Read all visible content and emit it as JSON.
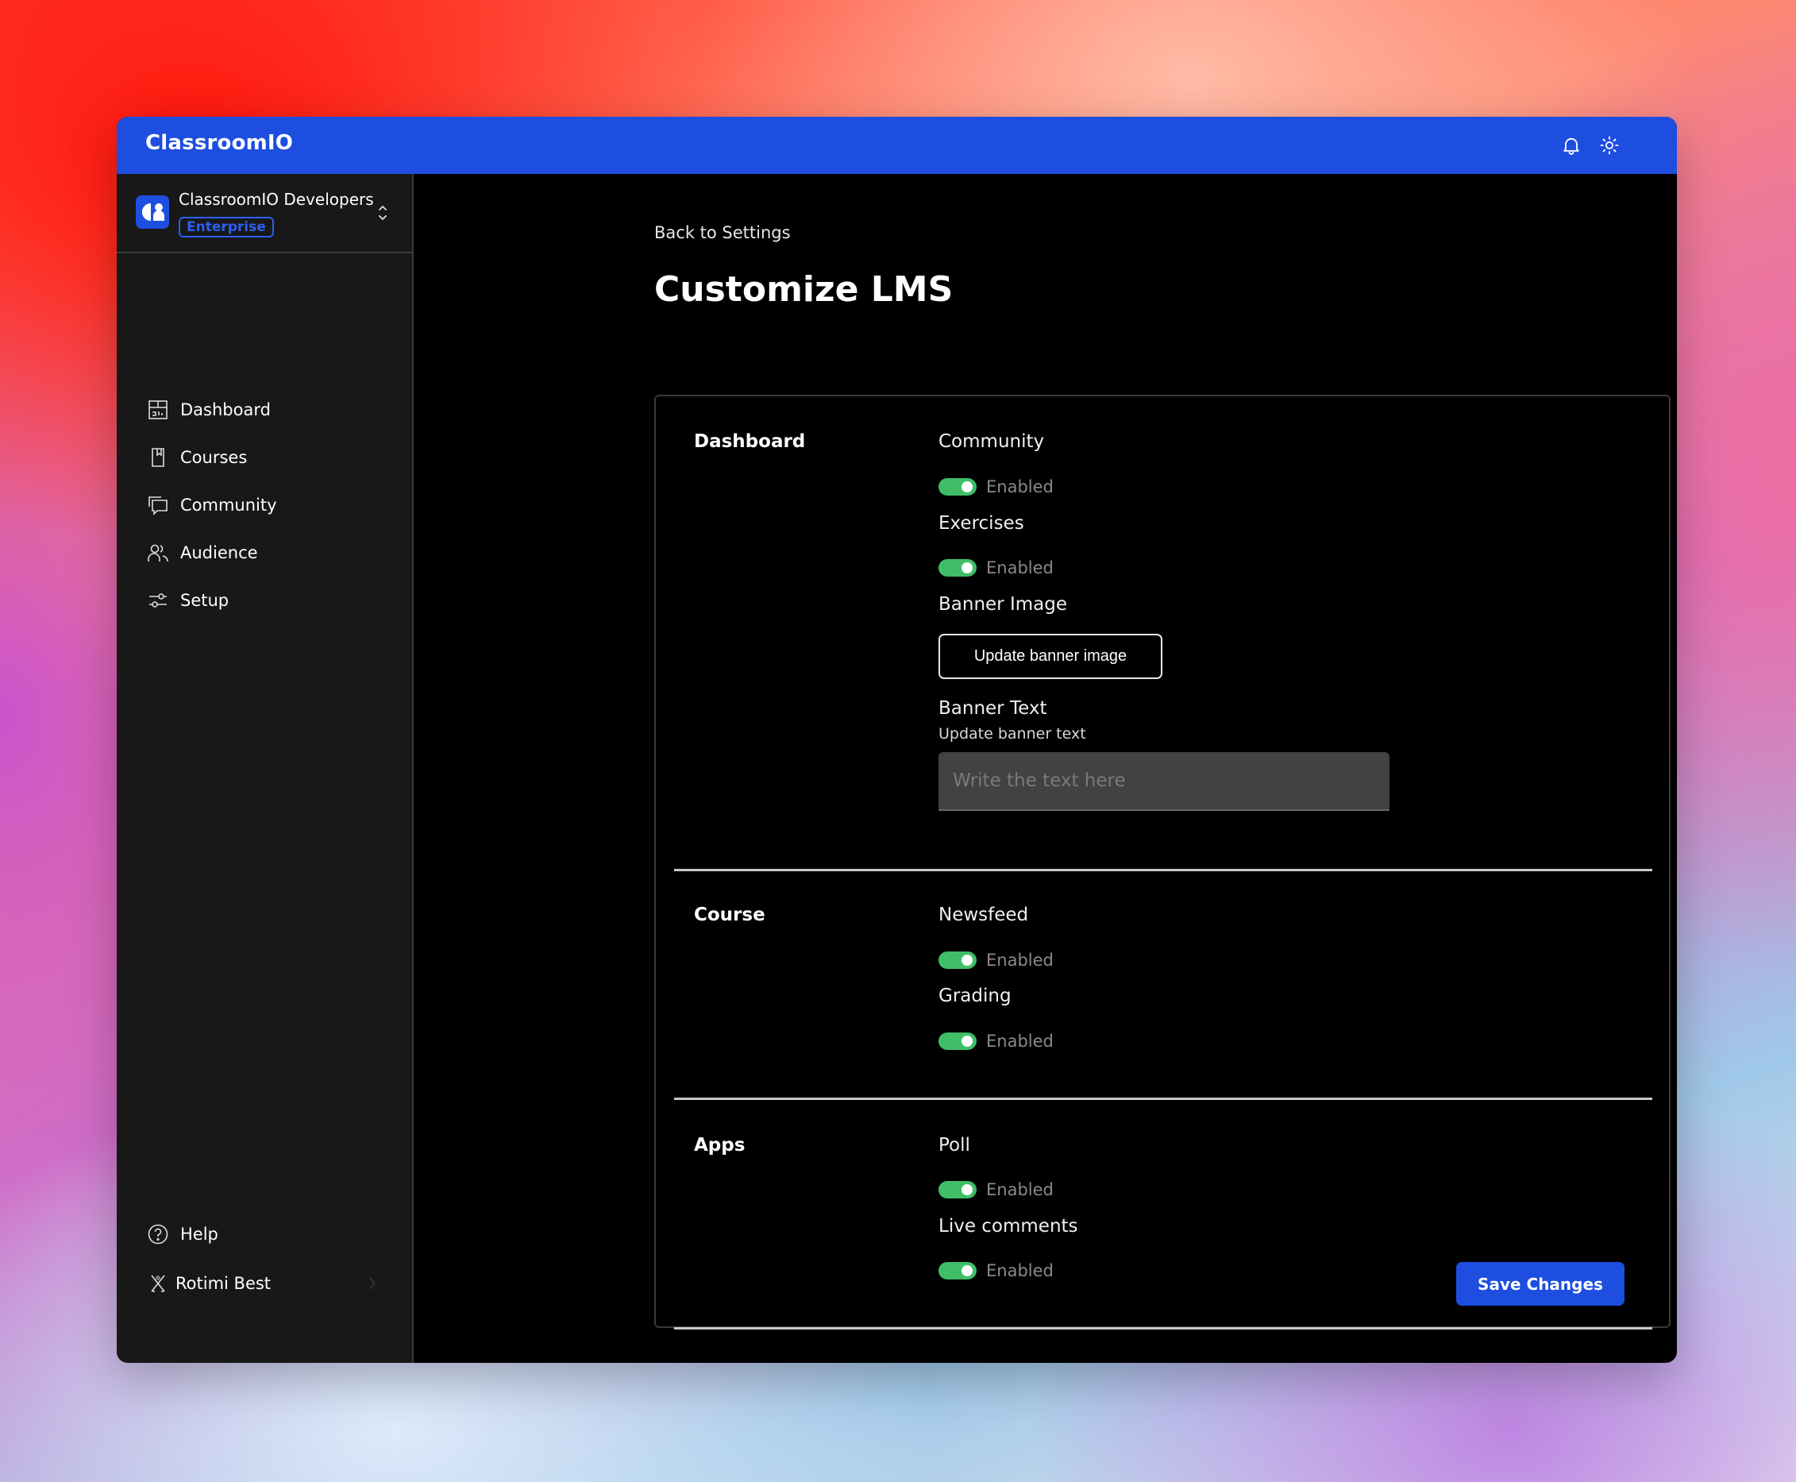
{
  "app": {
    "title": "ClassroomIO",
    "header_icons": [
      "bell-icon",
      "sun-icon"
    ]
  },
  "sidebar": {
    "org": {
      "name": "ClassroomIO Developers",
      "plan_badge": "Enterprise"
    },
    "nav": [
      {
        "label": "Dashboard",
        "icon": "dashboard-icon"
      },
      {
        "label": "Courses",
        "icon": "book-icon"
      },
      {
        "label": "Community",
        "icon": "chat-icon"
      },
      {
        "label": "Audience",
        "icon": "users-icon"
      },
      {
        "label": "Setup",
        "icon": "sliders-icon"
      }
    ],
    "help_label": "Help",
    "user_name": "Rotimi Best"
  },
  "main": {
    "back_link": "Back to Settings",
    "title": "Customize LMS",
    "sections": {
      "dashboard": {
        "label": "Dashboard",
        "community": {
          "label": "Community",
          "state": "Enabled",
          "enabled": true
        },
        "exercises": {
          "label": "Exercises",
          "state": "Enabled",
          "enabled": true
        },
        "banner_image": {
          "label": "Banner Image",
          "button": "Update banner image"
        },
        "banner_text": {
          "label": "Banner Text",
          "sublabel": "Update banner text",
          "placeholder": "Write the text here",
          "value": ""
        }
      },
      "course": {
        "label": "Course",
        "newsfeed": {
          "label": "Newsfeed",
          "state": "Enabled",
          "enabled": true
        },
        "grading": {
          "label": "Grading",
          "state": "Enabled",
          "enabled": true
        }
      },
      "apps": {
        "label": "Apps",
        "poll": {
          "label": "Poll",
          "state": "Enabled",
          "enabled": true
        },
        "live_comments": {
          "label": "Live comments",
          "state": "Enabled",
          "enabled": true
        }
      }
    },
    "save_button": "Save Changes"
  },
  "colors": {
    "brand": "#1d4ee0",
    "toggle_on": "#3fbe67",
    "sidebar_bg": "#181818",
    "main_bg": "#000000"
  }
}
